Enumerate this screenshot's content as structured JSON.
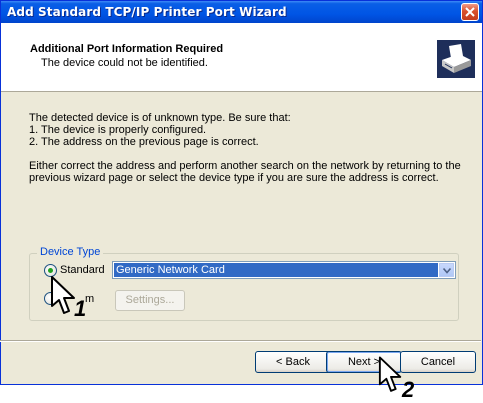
{
  "window": {
    "title": "Add Standard TCP/IP Printer Port Wizard"
  },
  "header": {
    "title": "Additional Port Information Required",
    "subtitle": "The device could not be identified."
  },
  "body": {
    "intro": "The detected device is of unknown type.  Be sure that:",
    "item1": "1. The device is properly configured.",
    "item2": "2. The address on the previous page is correct.",
    "para1_line1": "Either correct the address and perform another search on the network by returning to the",
    "para1_line2": "previous wizard page or select the device type if you are sure the address is correct."
  },
  "device_type": {
    "legend": "Device Type",
    "standard_label": "Standard",
    "custom_label_visible": "m",
    "standard_selected": true,
    "combo_value": "Generic Network Card",
    "settings_label": "Settings..."
  },
  "footer": {
    "back_label": "< Back",
    "next_label": "Next >",
    "cancel_label": "Cancel"
  },
  "callouts": {
    "one": "1",
    "two": "2"
  },
  "colors": {
    "titlebar": "#0055e5",
    "dialog_bg": "#ece9d8",
    "selection": "#316ac5",
    "legend": "#0046d5"
  },
  "icons": [
    "close-icon",
    "printer-icon",
    "chevron-down-icon",
    "mouse-cursor-icon"
  ]
}
